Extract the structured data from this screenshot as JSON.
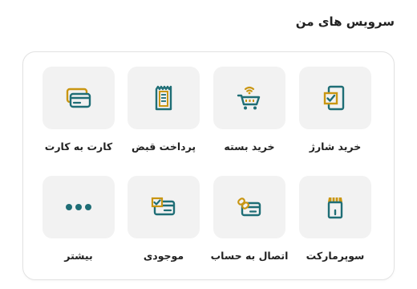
{
  "section": {
    "title": "سرویس های من"
  },
  "colors": {
    "teal": "#1f6e76",
    "gold": "#c99612",
    "tile_bg": "#f2f2f2"
  },
  "services": [
    {
      "label": "خرید شارژ",
      "icon": "phone-check-icon"
    },
    {
      "label": "خرید بسته",
      "icon": "cart-wifi-icon"
    },
    {
      "label": "پرداخت قبض",
      "icon": "receipt-icon"
    },
    {
      "label": "کارت به کارت",
      "icon": "cards-icon"
    },
    {
      "label": "سوپرمارکت",
      "icon": "store-icon"
    },
    {
      "label": "اتصال به حساب",
      "icon": "link-card-icon"
    },
    {
      "label": "موجودی",
      "icon": "balance-card-icon"
    },
    {
      "label": "بیشتر",
      "icon": "more-dots-icon"
    }
  ]
}
